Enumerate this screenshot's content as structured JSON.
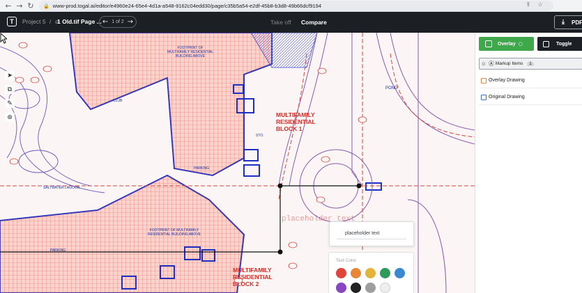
{
  "browser": {
    "url": "www-prod.togal.ai/editor/e4960e24-65e4-4d1a-a548-9162c04edd30/page/c35b5a54-e2df-45b8-b3d8-49b66dcf9194",
    "back_icon": "arrow-left-icon",
    "forward_icon": "arrow-right-icon",
    "reload_icon": "reload-icon",
    "lock_icon": "lock-icon",
    "share_icon": "share-icon",
    "star_icon": "star-icon"
  },
  "header": {
    "logo": "T",
    "breadcrumb_project": "Project 5",
    "breadcrumb_sep": "/",
    "file_name": "1 Old.tif Page ...",
    "pager_label": "1 of 2",
    "tabs": [
      {
        "label": "Take off",
        "active": false
      },
      {
        "label": "Compare",
        "active": true
      }
    ],
    "pdf_label": "PDF"
  },
  "canvas": {
    "tools": [
      "pointer-icon",
      "copy-icon",
      "ruler-icon",
      "annotate-icon"
    ],
    "labels": {
      "block1": [
        "MULTIFAMILY",
        "RESIDENTIAL",
        "BLOCK 1"
      ],
      "block2": [
        "MULTIFAMILY",
        "RESIDENTIAL",
        "BLOCK 2"
      ],
      "footprint_top": [
        "FOOTPRINT OF",
        "MULTIFAMILY RESIDENTIAL",
        "BUILDING ABOVE"
      ],
      "footprint_bottom": [
        "FOOTPRINT OF MULTIFAMILY",
        "RESIDENTIAL BUILDING ABOVE"
      ],
      "pond": "POND",
      "saltwater": "SALTWATER LAGOON",
      "parking_1": "PARKING",
      "parking_2": "PARKING",
      "club": "CLUB",
      "sto": "STO."
    },
    "placeholder_ghost": "placeholder text",
    "text_input_value": "placeholder text",
    "text_color_title": "Text Color",
    "swatches": [
      "#e0453a",
      "#e8873a",
      "#e3b43a",
      "#2f9b5a",
      "#3a88d2",
      "#8a46c2",
      "#222222",
      "#9e9e9e",
      "#eeeeee"
    ]
  },
  "panel": {
    "overlay_label": "Overlay",
    "toggle_label": "Toggle",
    "markup_label": "Markup Items",
    "markup_count": "1",
    "layers": [
      {
        "label": "Overlay Drawing",
        "color": "#e8873a"
      },
      {
        "label": "Original Drawing",
        "color": "#3a6fd2"
      }
    ]
  }
}
